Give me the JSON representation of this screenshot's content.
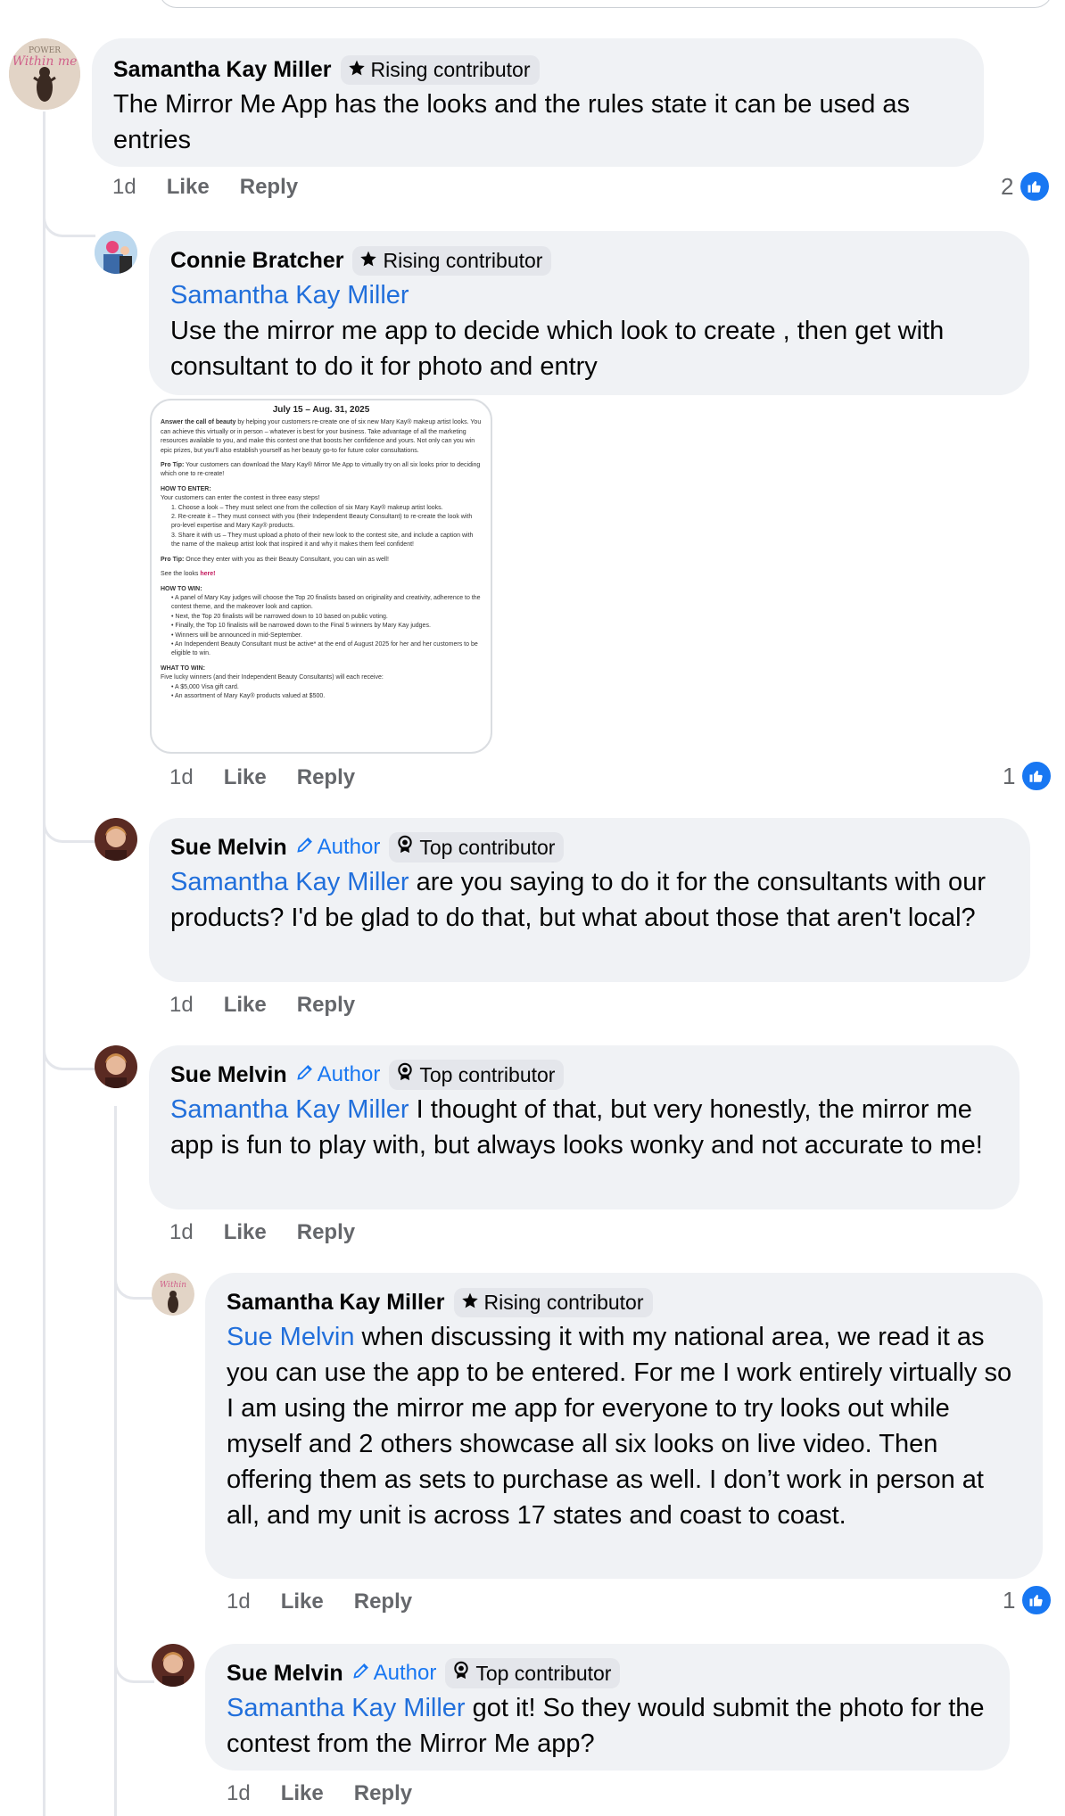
{
  "actions": {
    "like": "Like",
    "reply": "Reply"
  },
  "badges": {
    "rising": "Rising contributor",
    "top": "Top contributor",
    "author": "Author"
  },
  "comments": [
    {
      "name": "Samantha Kay Miller",
      "text": "The Mirror Me App has the looks and the rules state it can be used as entries",
      "time": "1d",
      "reactions": "2"
    },
    {
      "name": "Connie Bratcher",
      "mention": "Samantha Kay Miller",
      "text": " Use the mirror me app to decide which look to create , then get with consultant  to do it for photo and entry",
      "time": "1d",
      "reactions": "1"
    },
    {
      "name": "Sue Melvin",
      "mention": "Samantha Kay Miller",
      "text": " are you saying to do it for the consultants with our products? I'd be glad to do that, but what about those that aren't local?",
      "time": "1d"
    },
    {
      "name": "Sue Melvin",
      "mention": "Samantha Kay Miller",
      "text": " I thought of that, but very honestly, the mirror me app is fun to play with, but always looks wonky and not accurate to me!",
      "time": "1d"
    },
    {
      "name": "Samantha Kay Miller",
      "mention": "Sue Melvin",
      "text": " when discussing it with my national area, we read it as you can use the app to be entered. For me I work entirely virtually so I am using the mirror me app for everyone to try looks out while myself and 2 others showcase all six looks on live video. Then offering them as sets to purchase as well. I don’t work in person at all, and my unit is across 17 states and coast to coast.",
      "time": "1d",
      "reactions": "1"
    },
    {
      "name": "Sue Melvin",
      "mention": "Samantha Kay Miller",
      "text": " got it! So they would submit the photo for the contest from the Mirror Me app?",
      "time": "1d"
    }
  ],
  "attachment": {
    "title": "July 15 – Aug. 31, 2025",
    "intro_bold": "Answer the call of beauty",
    "intro": " by helping your customers re-create one of six new Mary Kay® makeup artist looks. You can achieve this virtually or in person – whatever is best for your business. Take advantage of all the marketing resources available to you, and make this contest one that boosts her confidence and yours. Not only can you win epic prizes, but you'll also establish yourself as her beauty go-to for future color consultations.",
    "protip1_label": "Pro Tip:",
    "protip1": " Your customers can download the Mary Kay® Mirror Me App to virtually try on all six looks prior to deciding which one to re-create!",
    "how_enter_label": "HOW TO ENTER:",
    "how_enter_sub": "Your customers can enter the contest in three easy steps!",
    "step1": "1. Choose a look – They must select one from the collection of six Mary Kay® makeup artist looks.",
    "step2": "2. Re-create it – They must connect with you (their Independent Beauty Consultant) to re-create the look with pro-level expertise and Mary Kay® products.",
    "step3": "3. Share it with us – They must upload a photo of their new look to the contest site, and include a caption with the name of the makeup artist look that inspired it and why it makes them feel confident!",
    "protip2_label": "Pro Tip:",
    "protip2": " Once they enter with you as their Beauty Consultant, you can win as well!",
    "see_looks": "See the looks ",
    "here": "here!",
    "how_win_label": "HOW TO WIN:",
    "win1": "• A panel of Mary Kay judges will choose the Top 20 finalists based on originality and creativity, adherence to the contest theme, and the makeover look and caption.",
    "win2": "• Next, the Top 20 finalists will be narrowed down to 10 based on public voting.",
    "win3": "• Finally, the Top 10 finalists will be narrowed down to the Final 5 winners by Mary Kay judges.",
    "win4": "• Winners will be announced in mid-September.",
    "win5": "• An Independent Beauty Consultant must be active* at the end of August 2025 for her and her customers to be eligible to win.",
    "what_win_label": "WHAT TO WIN:",
    "what_win_sub": "Five lucky winners (and their Independent Beauty Consultants) will each receive:",
    "prize1": "• A $5,000 Visa gift card.",
    "prize2": "• An assortment of Mary Kay® products valued at $500."
  },
  "colors": {
    "accent": "#1877f2",
    "mention": "#216fdb",
    "bubble": "#f0f2f5"
  }
}
